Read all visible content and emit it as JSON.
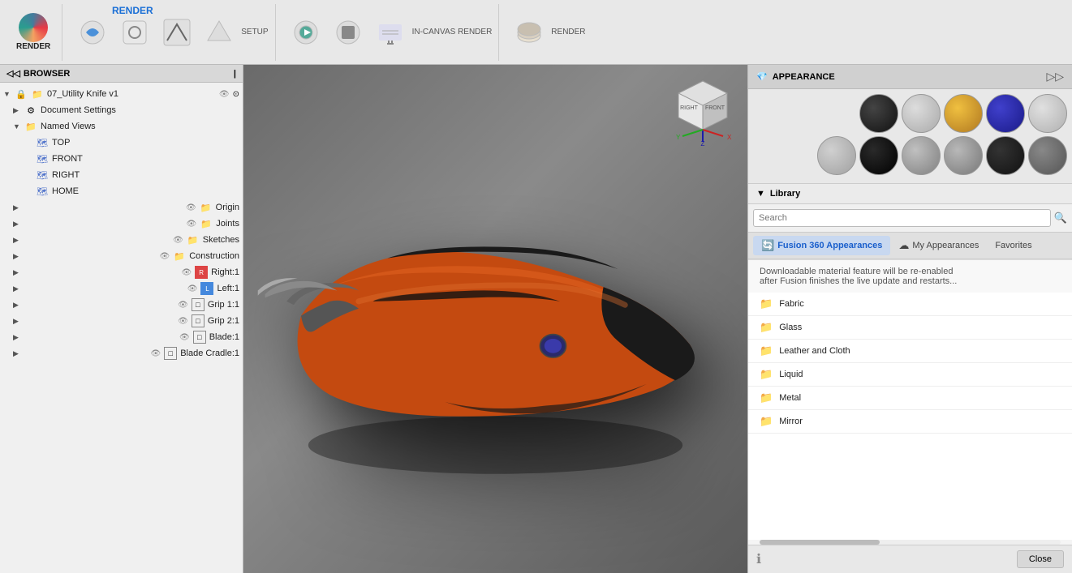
{
  "toolbar": {
    "render_label": "RENDER",
    "render_btn": "RENDER",
    "setup_label": "SETUP",
    "in_canvas_render_label": "IN-CANVAS RENDER",
    "render_export_label": "RENDER"
  },
  "browser": {
    "header": "BROWSER",
    "document": "07_Utility Knife v1",
    "items": [
      {
        "id": "document-settings",
        "label": "Document Settings",
        "indent": 1,
        "expandable": true,
        "icon": "⚙"
      },
      {
        "id": "named-views",
        "label": "Named Views",
        "indent": 1,
        "expandable": true,
        "expanded": true,
        "icon": "📁"
      },
      {
        "id": "top",
        "label": "TOP",
        "indent": 2,
        "icon": "🗺"
      },
      {
        "id": "front",
        "label": "FRONT",
        "indent": 2,
        "icon": "🗺"
      },
      {
        "id": "right",
        "label": "RIGHT",
        "indent": 2,
        "icon": "🗺"
      },
      {
        "id": "home",
        "label": "HOME",
        "indent": 2,
        "icon": "🗺"
      },
      {
        "id": "origin",
        "label": "Origin",
        "indent": 1,
        "expandable": true,
        "icon": "📁",
        "hidden": true
      },
      {
        "id": "joints",
        "label": "Joints",
        "indent": 1,
        "expandable": true,
        "icon": "📁",
        "hidden": true
      },
      {
        "id": "sketches",
        "label": "Sketches",
        "indent": 1,
        "expandable": true,
        "icon": "📁",
        "hidden": true
      },
      {
        "id": "construction",
        "label": "Construction",
        "indent": 1,
        "expandable": true,
        "icon": "📁",
        "hidden": true
      },
      {
        "id": "right1",
        "label": "Right:1",
        "indent": 1,
        "expandable": true,
        "icon": "📄"
      },
      {
        "id": "left1",
        "label": "Left:1",
        "indent": 1,
        "expandable": true,
        "icon": "📄"
      },
      {
        "id": "grip11",
        "label": "Grip 1:1",
        "indent": 1,
        "expandable": true,
        "icon": "📄"
      },
      {
        "id": "grip21",
        "label": "Grip 2:1",
        "indent": 1,
        "expandable": true,
        "icon": "📄"
      },
      {
        "id": "blade1",
        "label": "Blade:1",
        "indent": 1,
        "expandable": true,
        "icon": "📄"
      },
      {
        "id": "blade-cradle1",
        "label": "Blade Cradle:1",
        "indent": 1,
        "expandable": true,
        "icon": "📄"
      }
    ]
  },
  "appearance": {
    "header": "APPEARANCE",
    "library_label": "Library",
    "search_placeholder": "Search",
    "tabs": [
      {
        "id": "fusion360",
        "label": "Fusion 360 Appearances",
        "active": true,
        "icon": "🔄"
      },
      {
        "id": "my-appearances",
        "label": "My Appearances",
        "active": false,
        "icon": "☁"
      },
      {
        "id": "favorites",
        "label": "Favorites",
        "active": false
      }
    ],
    "info_line1": "Downloadable material feature will be re-enabled",
    "info_line2": "after Fusion finishes the live update and restarts...",
    "categories": [
      {
        "id": "fabric",
        "label": "Fabric"
      },
      {
        "id": "glass",
        "label": "Glass"
      },
      {
        "id": "leather-cloth",
        "label": "Leather and Cloth"
      },
      {
        "id": "liquid",
        "label": "Liquid"
      },
      {
        "id": "metal",
        "label": "Metal"
      },
      {
        "id": "mirror",
        "label": "Mirror"
      }
    ],
    "close_btn": "Close",
    "swatches": [
      {
        "id": "s1",
        "color": "#1a1a1a"
      },
      {
        "id": "s2",
        "color": "#c0c0c0"
      },
      {
        "id": "s3",
        "color": "#d4a017"
      },
      {
        "id": "s4",
        "color": "#1a1aaa"
      },
      {
        "id": "s5",
        "color": "#c8c8c8"
      },
      {
        "id": "s6",
        "color": "#b0b0b0"
      },
      {
        "id": "s7",
        "color": "#1a1a1a"
      },
      {
        "id": "s8",
        "color": "#a0a0a0"
      },
      {
        "id": "s9",
        "color": "#888"
      },
      {
        "id": "s10",
        "color": "#1a1a1a"
      },
      {
        "id": "s11",
        "color": "#707070"
      }
    ]
  },
  "gizmo": {
    "front_label": "FRONT",
    "right_label": "RIGHT",
    "axes": {
      "x": "X",
      "y": "Y",
      "z": "Z"
    }
  }
}
